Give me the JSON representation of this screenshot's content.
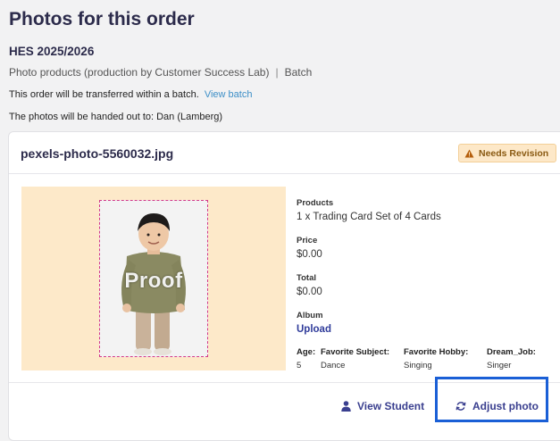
{
  "page": {
    "title": "Photos for this order",
    "order_name": "HES 2025/2026",
    "product_line": "Photo products (production by Customer Success Lab)",
    "product_separator": "|",
    "product_mode": "Batch",
    "transfer_text": "This order will be transferred within a batch.",
    "transfer_link": "View batch",
    "handout_text": "The photos will be handed out to: Dan (Lamberg)"
  },
  "photo_card": {
    "file_name": "pexels-photo-5560032.jpg",
    "status_badge": "Needs Revision",
    "watermark": "Proof",
    "details": {
      "products_label": "Products",
      "products_value": "1 x Trading Card Set of 4 Cards",
      "price_label": "Price",
      "price_value": "$0.00",
      "total_label": "Total",
      "total_value": "$0.00",
      "album_label": "Album",
      "album_value": "Upload"
    },
    "attributes": [
      {
        "key": "Age:",
        "value": "5"
      },
      {
        "key": "Favorite Subject:",
        "value": "Dance"
      },
      {
        "key": "Favorite Hobby:",
        "value": "Singing"
      },
      {
        "key": "Dream_Job:",
        "value": "Singer"
      }
    ],
    "actions": {
      "view_student": "View Student",
      "adjust_photo": "Adjust photo"
    }
  },
  "colors": {
    "accent": "#3a3f8f",
    "link": "#3d8fc7",
    "badge_bg": "#fde8c8",
    "photo_bg": "#fde9c9",
    "highlight": "#1a5fd6"
  },
  "icons": {
    "badge": "warning-icon",
    "view_student": "user-icon",
    "adjust_photo": "refresh-icon"
  }
}
